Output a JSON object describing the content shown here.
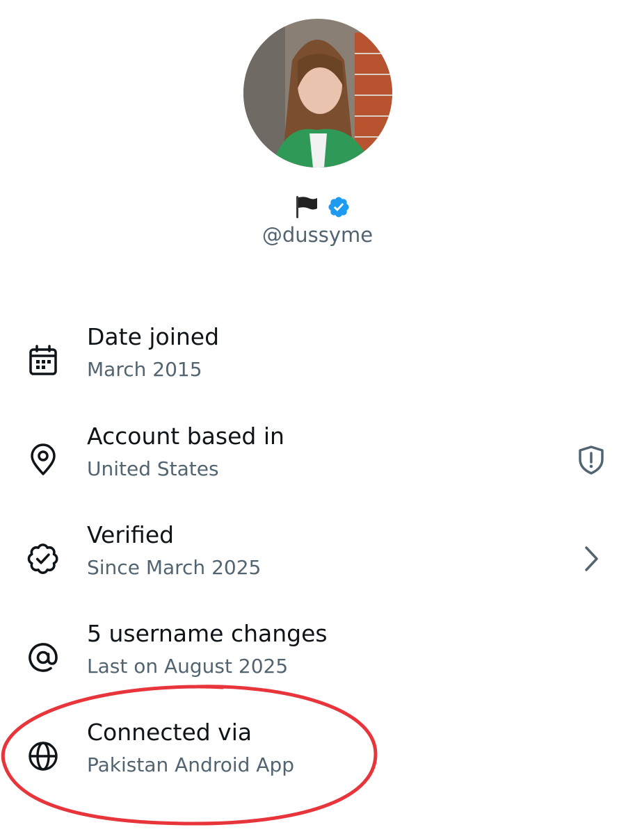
{
  "profile": {
    "display_name": "",
    "handle": "@dussyme",
    "flag_icon": "black-flag-icon",
    "badge_icon": "verified-badge-icon",
    "badge_color": "#1d9bf0",
    "avatar_icon": "profile-photo"
  },
  "rows": [
    {
      "icon": "calendar-icon",
      "title": "Date joined",
      "subtitle": "March 2015"
    },
    {
      "icon": "location-pin-icon",
      "title": "Account based in",
      "subtitle": "United States",
      "trailing_icon": "shield-alert-icon"
    },
    {
      "icon": "verified-seal-icon",
      "title": "Verified",
      "subtitle": "Since March 2025",
      "trailing_icon": "chevron-right-icon"
    },
    {
      "icon": "at-sign-icon",
      "title": "5 username changes",
      "subtitle": "Last on August 2025"
    },
    {
      "icon": "globe-icon",
      "title": "Connected via",
      "subtitle": "Pakistan Android App"
    }
  ],
  "colors": {
    "primary_text": "#0f1419",
    "secondary_text": "#536471",
    "annotation": "#e8353c"
  }
}
